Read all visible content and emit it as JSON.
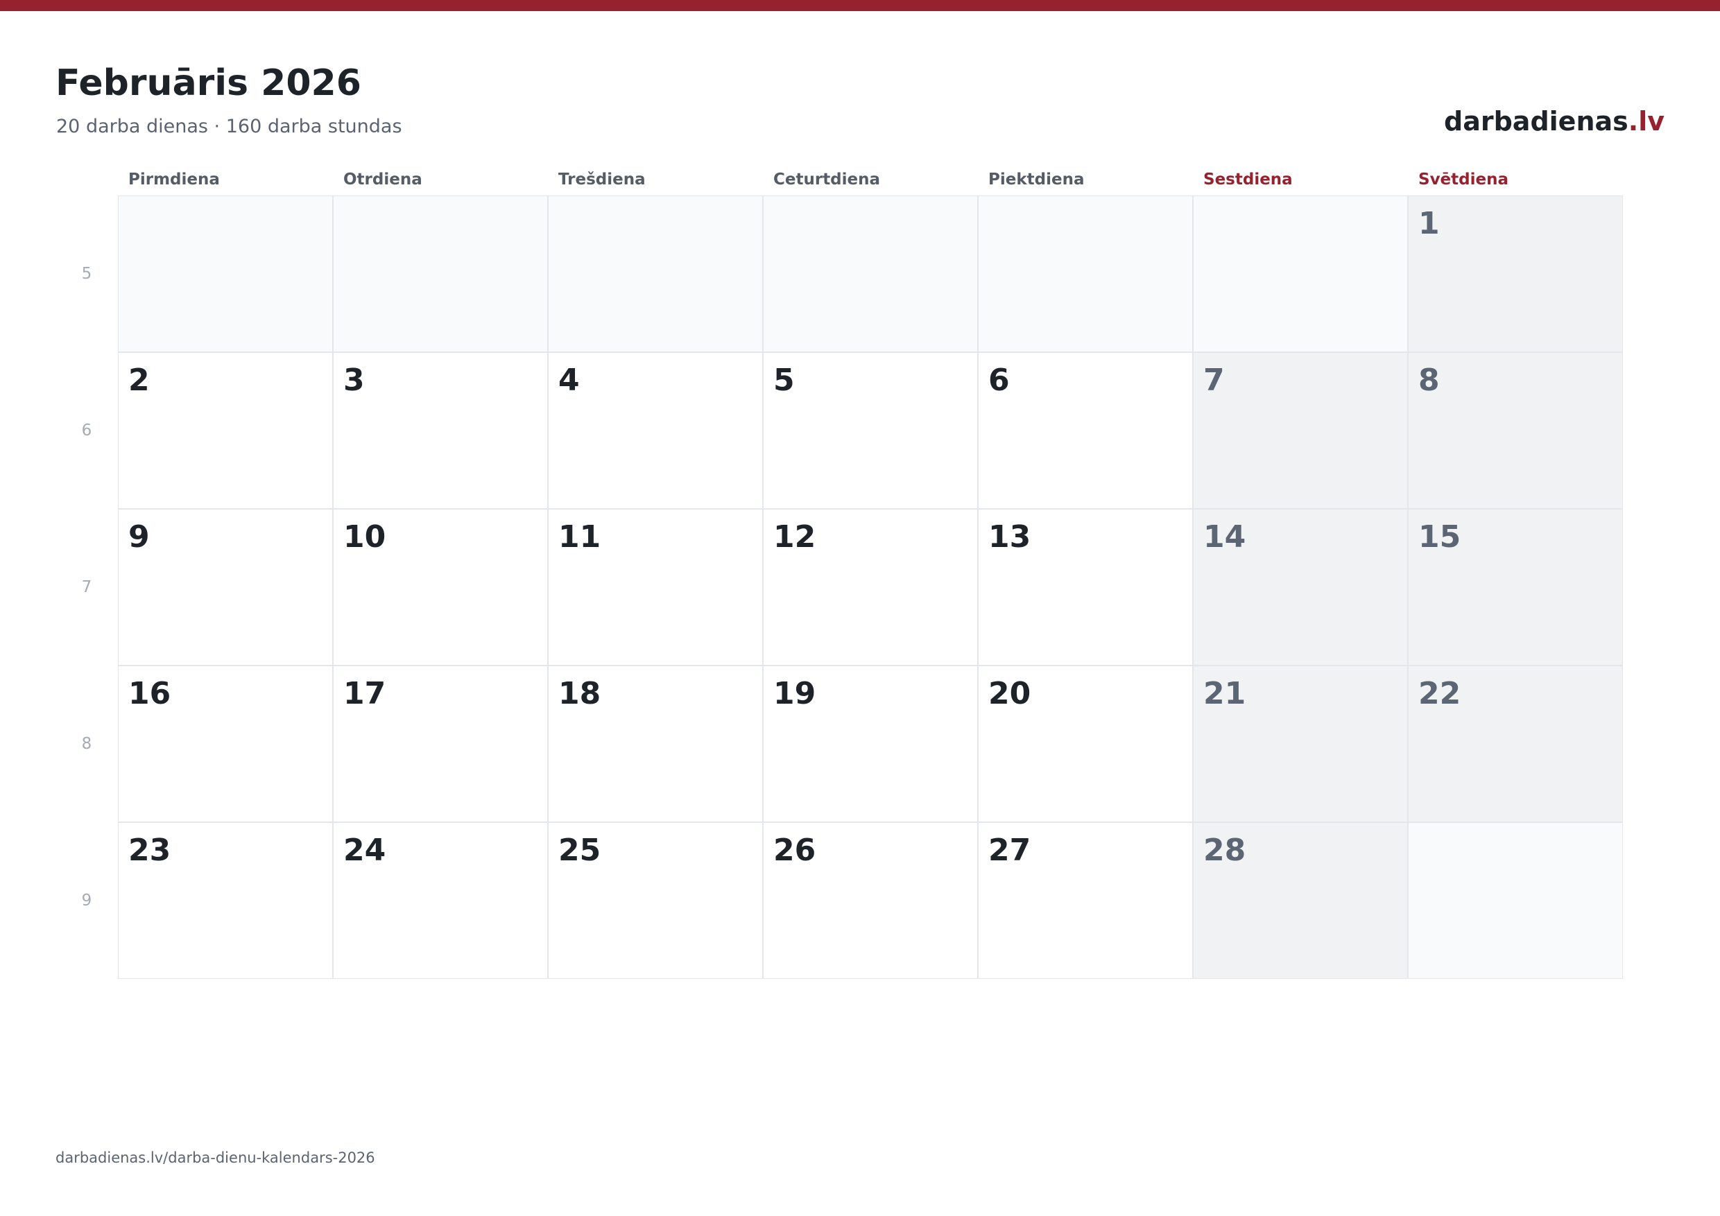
{
  "header": {
    "title": "Februāris 2026",
    "subtitle": "20 darba dienas · 160 darba stundas",
    "brand_name": "darbadienas",
    "brand_tld": ".lv"
  },
  "colors": {
    "accent": "#96222f",
    "text": "#1e2329",
    "muted": "#5c6370",
    "weekend_cell": "#f1f2f4",
    "empty_cell": "#f9fafb"
  },
  "weekdays": [
    {
      "label": "Pirmdiena",
      "weekend": false
    },
    {
      "label": "Otrdiena",
      "weekend": false
    },
    {
      "label": "Trešdiena",
      "weekend": false
    },
    {
      "label": "Ceturtdiena",
      "weekend": false
    },
    {
      "label": "Piektdiena",
      "weekend": false
    },
    {
      "label": "Sestdiena",
      "weekend": true
    },
    {
      "label": "Svētdiena",
      "weekend": true
    }
  ],
  "weeks": [
    {
      "number": "5",
      "days": [
        "",
        "",
        "",
        "",
        "",
        "",
        "1"
      ]
    },
    {
      "number": "6",
      "days": [
        "2",
        "3",
        "4",
        "5",
        "6",
        "7",
        "8"
      ]
    },
    {
      "number": "7",
      "days": [
        "9",
        "10",
        "11",
        "12",
        "13",
        "14",
        "15"
      ]
    },
    {
      "number": "8",
      "days": [
        "16",
        "17",
        "18",
        "19",
        "20",
        "21",
        "22"
      ]
    },
    {
      "number": "9",
      "days": [
        "23",
        "24",
        "25",
        "26",
        "27",
        "28",
        ""
      ]
    }
  ],
  "footer": {
    "url": "darbadienas.lv/darba-dienu-kalendars-2026"
  }
}
